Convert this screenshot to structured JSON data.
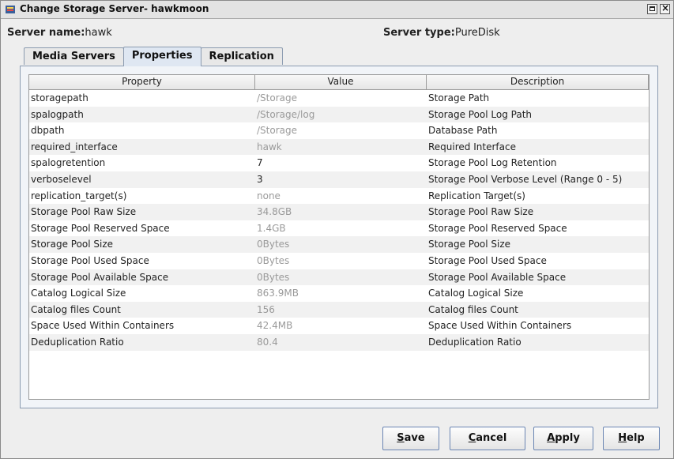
{
  "window": {
    "title": "Change Storage Server- hawkmoon"
  },
  "info": {
    "server_name_label": "Server name:",
    "server_name_value": "hawk",
    "server_type_label": "Server type:",
    "server_type_value": "PureDisk"
  },
  "tabs": [
    {
      "label": "Media Servers",
      "active": false
    },
    {
      "label": "Properties",
      "active": true
    },
    {
      "label": "Replication",
      "active": false
    }
  ],
  "table": {
    "columns": [
      "Property",
      "Value",
      "Description"
    ],
    "rows": [
      {
        "property": "storagepath",
        "value": "/Storage",
        "description": "Storage Path",
        "editable": false
      },
      {
        "property": "spalogpath",
        "value": "/Storage/log",
        "description": "Storage Pool Log Path",
        "editable": false
      },
      {
        "property": "dbpath",
        "value": "/Storage",
        "description": "Database Path",
        "editable": false
      },
      {
        "property": "required_interface",
        "value": "hawk",
        "description": "Required Interface",
        "editable": false
      },
      {
        "property": "spalogretention",
        "value": "7",
        "description": "Storage Pool Log Retention",
        "editable": true
      },
      {
        "property": "verboselevel",
        "value": "3",
        "description": "Storage Pool Verbose Level (Range 0 - 5)",
        "editable": true
      },
      {
        "property": "replication_target(s)",
        "value": "none",
        "description": "Replication Target(s)",
        "editable": false
      },
      {
        "property": "Storage Pool Raw Size",
        "value": "34.8GB",
        "description": "Storage Pool Raw Size",
        "editable": false
      },
      {
        "property": "Storage Pool Reserved Space",
        "value": "1.4GB",
        "description": "Storage Pool Reserved Space",
        "editable": false
      },
      {
        "property": "Storage Pool Size",
        "value": "0Bytes",
        "description": "Storage Pool Size",
        "editable": false
      },
      {
        "property": "Storage Pool Used Space",
        "value": "0Bytes",
        "description": "Storage Pool Used Space",
        "editable": false
      },
      {
        "property": "Storage Pool Available Space",
        "value": "0Bytes",
        "description": "Storage Pool Available Space",
        "editable": false
      },
      {
        "property": "Catalog Logical Size",
        "value": "863.9MB",
        "description": "Catalog Logical Size",
        "editable": false
      },
      {
        "property": "Catalog files Count",
        "value": "156",
        "description": "Catalog files Count",
        "editable": false
      },
      {
        "property": "Space Used Within Containers",
        "value": "42.4MB",
        "description": "Space Used Within Containers",
        "editable": false
      },
      {
        "property": "Deduplication Ratio",
        "value": "80.4",
        "description": "Deduplication Ratio",
        "editable": false
      }
    ]
  },
  "buttons": {
    "save": {
      "mnemonic": "S",
      "rest": "ave"
    },
    "cancel": {
      "mnemonic": "C",
      "rest": "ancel"
    },
    "apply": {
      "mnemonic": "A",
      "rest": "pply"
    },
    "help": {
      "mnemonic": "H",
      "rest": "elp"
    }
  },
  "colors": {
    "tab_active": "#dfe7f2",
    "panel_border": "#8b9bb0",
    "readonly_text": "#9a9a9a"
  },
  "icons": [
    "app-icon",
    "maximize-icon",
    "close-icon"
  ]
}
